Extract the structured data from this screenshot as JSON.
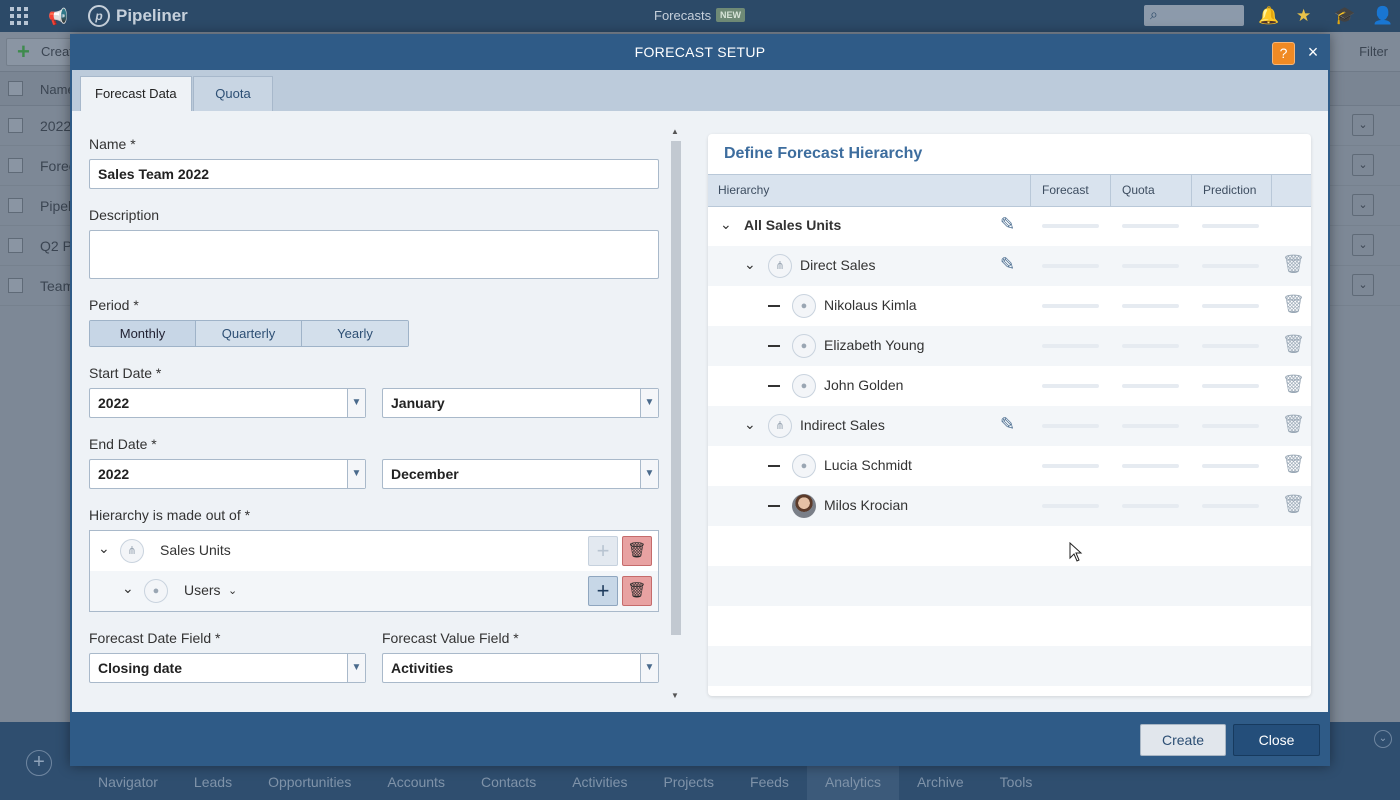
{
  "app": {
    "brand": "Pipeliner",
    "title": "Forecasts",
    "new_badge": "NEW",
    "toolbar_create": "Creat",
    "toolbar_filter": "Filter",
    "list_header": "Name",
    "list_rows": [
      "2022",
      "Forec",
      "Pipel",
      "Q2 P",
      "Team"
    ],
    "bottom_nav": [
      "Navigator",
      "Leads",
      "Opportunities",
      "Accounts",
      "Contacts",
      "Activities",
      "Projects",
      "Feeds",
      "Analytics",
      "Archive",
      "Tools"
    ],
    "bottom_nav_active": "Analytics"
  },
  "modal": {
    "title": "FORECAST SETUP",
    "help": "?",
    "close_icon": "×",
    "tabs": [
      "Forecast Data",
      "Quota"
    ],
    "active_tab": "Forecast Data"
  },
  "form": {
    "name_label": "Name *",
    "name_value": "Sales Team 2022",
    "description_label": "Description",
    "description_value": "",
    "period_label": "Period *",
    "period_options": [
      "Monthly",
      "Quarterly",
      "Yearly"
    ],
    "start_label": "Start Date *",
    "start_year": "2022",
    "start_month": "January",
    "end_label": "End Date *",
    "end_year": "2022",
    "end_month": "December",
    "hierarchy_label": "Hierarchy is made out of *",
    "hierarchy_levels": [
      "Sales Units",
      "Users"
    ],
    "date_field_label": "Forecast Date Field *",
    "date_field_value": "Closing date",
    "value_field_label": "Forecast Value Field *",
    "value_field_value": "Activities"
  },
  "panel": {
    "title": "Define Forecast Hierarchy",
    "columns": [
      "Hierarchy",
      "Forecast",
      "Quota",
      "Prediction"
    ],
    "rows": [
      {
        "label": "All Sales Units",
        "kind": "root"
      },
      {
        "label": "Direct Sales",
        "kind": "unit"
      },
      {
        "label": "Nikolaus Kimla",
        "kind": "user"
      },
      {
        "label": "Elizabeth Young",
        "kind": "user"
      },
      {
        "label": "John Golden",
        "kind": "user"
      },
      {
        "label": "Indirect Sales",
        "kind": "unit"
      },
      {
        "label": "Lucia Schmidt",
        "kind": "user"
      },
      {
        "label": "Milos Krocian",
        "kind": "user-photo"
      }
    ]
  },
  "footer": {
    "create_label": "Create",
    "close_label": "Close"
  },
  "icons": {
    "chevron": "⌄",
    "pencil": "✎",
    "trash": "🗑",
    "plus": "+"
  }
}
